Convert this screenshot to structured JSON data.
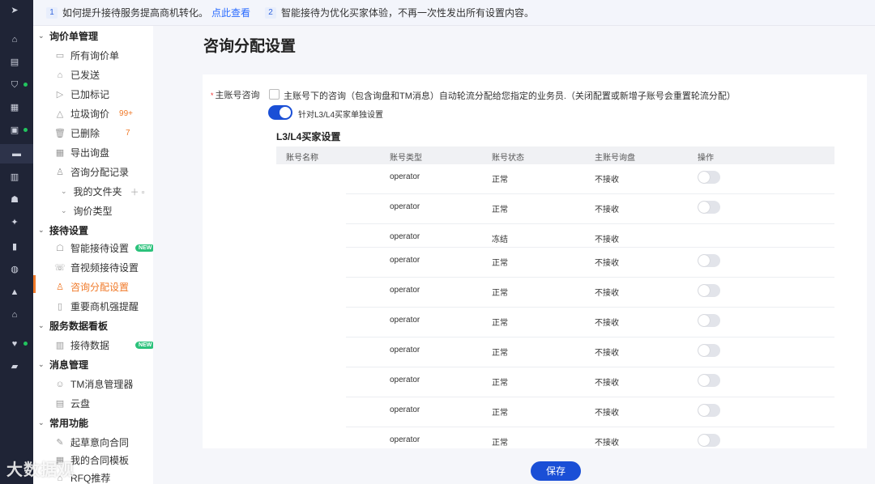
{
  "notice": {
    "n1": "1",
    "text1": "如何提升接待服务提高商机转化。",
    "link": "点此查看",
    "n2": "2",
    "text2": "智能接待为优化买家体验，不再一次性发出所有设置内容。"
  },
  "sidebar": {
    "groups": {
      "inquiry": "询价单管理",
      "reception": "接待设置",
      "dashboard": "服务数据看板",
      "message": "消息管理",
      "common": "常用功能"
    },
    "items": {
      "all": "所有询价单",
      "sent": "已发送",
      "marked": "已加标记",
      "spam": "垃圾询价",
      "spam_count": "99+",
      "deleted": "已删除",
      "deleted_count": "7",
      "export": "导出询盘",
      "assign_log": "咨询分配记录",
      "my_folder": "我的文件夹",
      "inquiry_type": "询价类型",
      "smart_reception": "智能接待设置",
      "av_reception": "音视频接待设置",
      "assign_settings": "咨询分配设置",
      "important_alert": "重要商机强提醒",
      "reception_data": "接待数据",
      "tm_manager": "TM消息管理器",
      "cloud_disk": "云盘",
      "draft_contract": "起草意向合同",
      "my_templates": "我的合同模板",
      "rfq": "RFQ推荐"
    },
    "new_badge": "NEW"
  },
  "main": {
    "title": "咨询分配设置",
    "field_label": "主账号咨询",
    "checkbox_text": "主账号下的咨询（包含询盘和TM消息）自动轮流分配给您指定的业务员.（关闭配置或新增子账号会重置轮流分配）",
    "toggle_text": "针对L3/L4买家单独设置",
    "section_title": "L3/L4买家设置",
    "save": "保存"
  },
  "table": {
    "headers": [
      "账号名称",
      "账号类型",
      "账号状态",
      "主账号询盘",
      "操作"
    ],
    "rows": [
      {
        "type": "operator",
        "status": "正常",
        "receive": "不接收",
        "switch": false
      },
      {
        "type": "operator",
        "status": "正常",
        "receive": "不接收",
        "switch": false
      },
      {
        "type": "operator",
        "status": "冻结",
        "receive": "不接收",
        "switch": null
      },
      {
        "type": "operator",
        "status": "正常",
        "receive": "不接收",
        "switch": false
      },
      {
        "type": "operator",
        "status": "正常",
        "receive": "不接收",
        "switch": false
      },
      {
        "type": "operator",
        "status": "正常",
        "receive": "不接收",
        "switch": false
      },
      {
        "type": "operator",
        "status": "正常",
        "receive": "不接收",
        "switch": false
      },
      {
        "type": "operator",
        "status": "正常",
        "receive": "不接收",
        "switch": false
      },
      {
        "type": "operator",
        "status": "正常",
        "receive": "不接收",
        "switch": false
      },
      {
        "type": "operator",
        "status": "正常",
        "receive": "不接收",
        "switch": false
      }
    ]
  },
  "watermark": "大数据观"
}
